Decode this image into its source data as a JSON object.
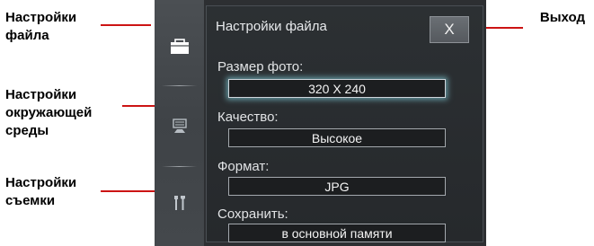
{
  "callouts": {
    "file_settings": "Настройки\nфайла",
    "environment_settings": "Настройки\nокружающей\nсреды",
    "shooting_settings": "Настройки\nсъемки",
    "exit": "Выход"
  },
  "colors": {
    "leader_line": "#cc1414",
    "screen_background": "#2d2f32",
    "active_field_glow": "#78bec8"
  },
  "sidebar": {
    "tabs": [
      {
        "id": "file",
        "icon": "folder-icon",
        "selected": true
      },
      {
        "id": "environment",
        "icon": "monitor-icon",
        "selected": false
      },
      {
        "id": "shooting",
        "icon": "tools-icon",
        "selected": false
      }
    ]
  },
  "panel": {
    "title": "Настройки файла",
    "close_label": "X",
    "fields": [
      {
        "label": "Размер фото:",
        "value": "320 X 240",
        "active": true
      },
      {
        "label": "Качество:",
        "value": "Высокое",
        "active": false
      },
      {
        "label": "Формат:",
        "value": "JPG",
        "active": false
      },
      {
        "label": "Сохранить:",
        "value": "в основной памяти",
        "active": false
      }
    ]
  }
}
